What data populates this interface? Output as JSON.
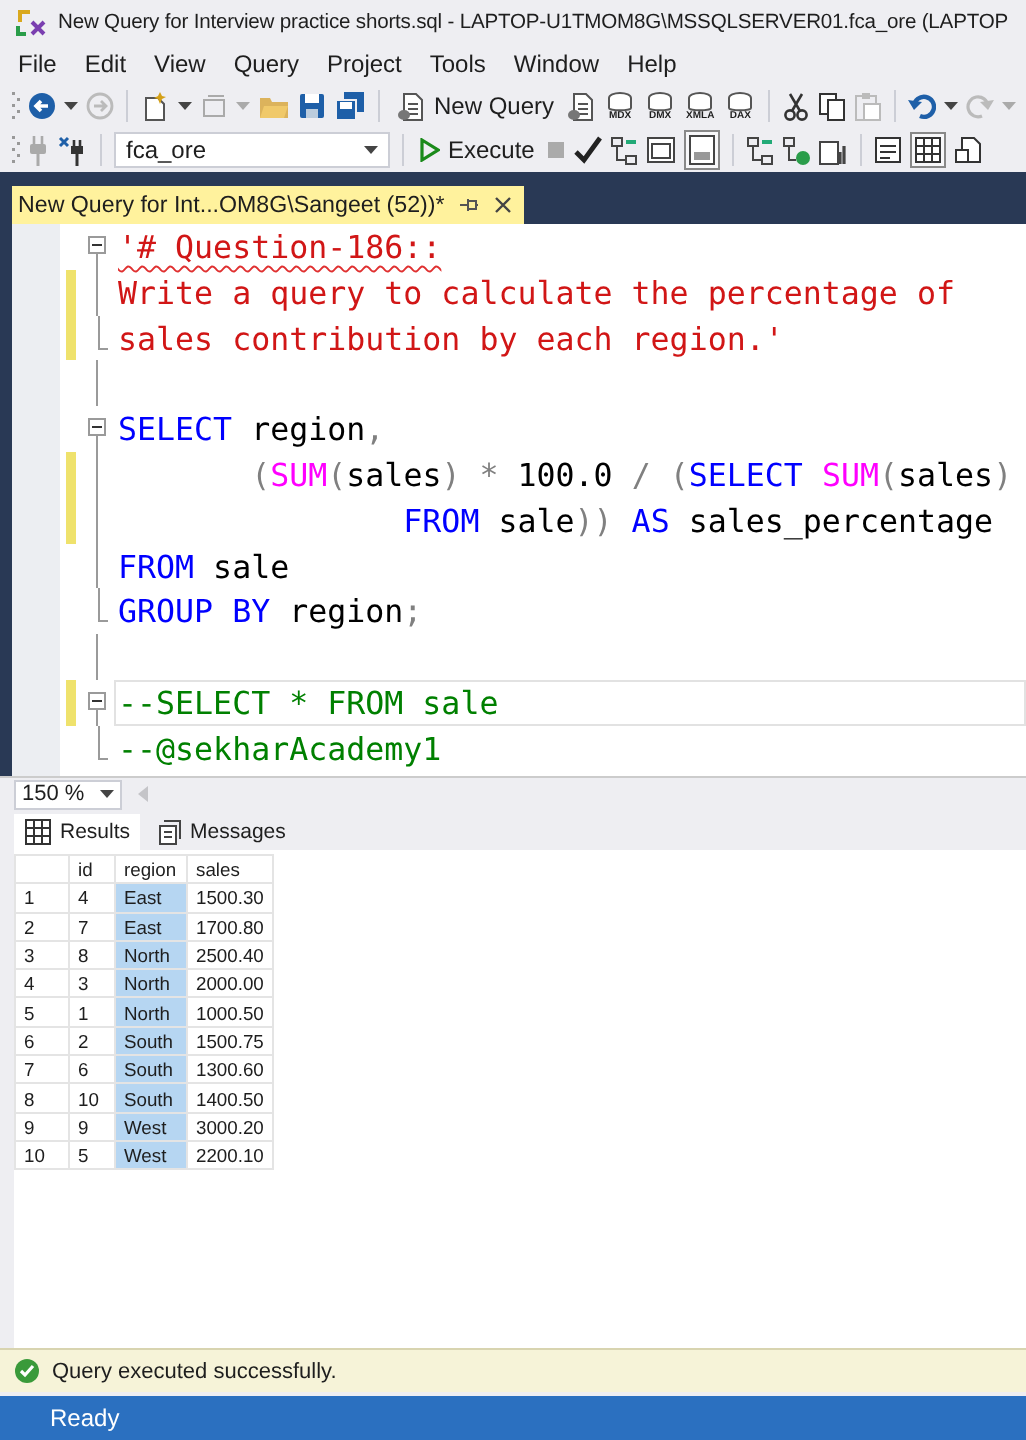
{
  "window": {
    "title": "New Query for Interview practice shorts.sql - LAPTOP-U1TMOM8G\\MSSQLSERVER01.fca_ore (LAPTOP"
  },
  "menu": [
    "File",
    "Edit",
    "View",
    "Query",
    "Project",
    "Tools",
    "Window",
    "Help"
  ],
  "toolbar": {
    "new_query": "New Query",
    "query_types": [
      "MDX",
      "DMX",
      "XMLA",
      "DAX"
    ],
    "database": "fca_ore",
    "execute": "Execute"
  },
  "document_tab": {
    "label": "New Query for Int...OM8G\\Sangeet (52))*",
    "selected": true
  },
  "editor": {
    "blocks": [
      {
        "expanded": true,
        "lines": [
          {
            "changed": false,
            "current": false,
            "squiggle": true,
            "tokens": [
              {
                "text": "'# Question-186::",
                "kind": "string"
              }
            ]
          },
          {
            "changed": true,
            "current": false,
            "squiggle": false,
            "tokens": [
              {
                "text": "Write a query to calculate the percentage of",
                "kind": "string"
              }
            ]
          },
          {
            "changed": true,
            "current": false,
            "squiggle": false,
            "tokens": [
              {
                "text": "sales contribution by each region.'",
                "kind": "string"
              }
            ]
          }
        ]
      },
      {
        "expanded": true,
        "lines": [
          {
            "changed": false,
            "current": false,
            "squiggle": false,
            "tokens": [
              {
                "text": "SELECT",
                "kind": "keyword"
              },
              {
                "text": " region",
                "kind": "plain"
              },
              {
                "text": ",",
                "kind": "operator"
              }
            ]
          },
          {
            "changed": true,
            "current": false,
            "squiggle": false,
            "tokens": [
              {
                "text": "       (",
                "kind": "operator"
              },
              {
                "text": "SUM",
                "kind": "function"
              },
              {
                "text": "(",
                "kind": "operator"
              },
              {
                "text": "sales",
                "kind": "plain"
              },
              {
                "text": ") * ",
                "kind": "operator"
              },
              {
                "text": "100.0",
                "kind": "plain"
              },
              {
                "text": " / (",
                "kind": "operator"
              },
              {
                "text": "SELECT ",
                "kind": "keyword"
              },
              {
                "text": "SUM",
                "kind": "function"
              },
              {
                "text": "(",
                "kind": "operator"
              },
              {
                "text": "sales",
                "kind": "plain"
              },
              {
                "text": ")",
                "kind": "operator"
              }
            ]
          },
          {
            "changed": true,
            "current": false,
            "squiggle": false,
            "tokens": [
              {
                "text": "               FROM",
                "kind": "keyword"
              },
              {
                "text": " sale",
                "kind": "plain"
              },
              {
                "text": "))",
                "kind": "operator"
              },
              {
                "text": " AS",
                "kind": "keyword"
              },
              {
                "text": " sales_percentage",
                "kind": "plain"
              }
            ]
          },
          {
            "changed": false,
            "current": false,
            "squiggle": false,
            "tokens": [
              {
                "text": "FROM",
                "kind": "keyword"
              },
              {
                "text": " sale",
                "kind": "plain"
              }
            ]
          },
          {
            "changed": false,
            "current": false,
            "squiggle": false,
            "tokens": [
              {
                "text": "GROUP BY",
                "kind": "keyword"
              },
              {
                "text": " region",
                "kind": "plain"
              },
              {
                "text": ";",
                "kind": "operator"
              }
            ]
          }
        ]
      },
      {
        "expanded": true,
        "lines": [
          {
            "changed": true,
            "current": true,
            "squiggle": false,
            "tokens": [
              {
                "text": "--SELECT * FROM sale",
                "kind": "comment"
              }
            ]
          },
          {
            "changed": false,
            "current": false,
            "squiggle": false,
            "tokens": [
              {
                "text": "--@sekharAcademy1",
                "kind": "comment"
              }
            ]
          }
        ]
      }
    ]
  },
  "zoom": "150 %",
  "result_tabs": [
    {
      "label": "Results",
      "selected": true
    },
    {
      "label": "Messages",
      "selected": false
    }
  ],
  "grid": {
    "columns": [
      {
        "label": "id",
        "selected": false
      },
      {
        "label": "region",
        "selected": true
      },
      {
        "label": "sales",
        "selected": false
      }
    ],
    "rows": [
      {
        "number": "1",
        "cells": [
          "4",
          "East",
          "1500.30"
        ]
      },
      {
        "number": "2",
        "cells": [
          "7",
          "East",
          "1700.80"
        ]
      },
      {
        "number": "3",
        "cells": [
          "8",
          "North",
          "2500.40"
        ]
      },
      {
        "number": "4",
        "cells": [
          "3",
          "North",
          "2000.00"
        ]
      },
      {
        "number": "5",
        "cells": [
          "1",
          "North",
          "1000.50"
        ]
      },
      {
        "number": "6",
        "cells": [
          "2",
          "South",
          "1500.75"
        ]
      },
      {
        "number": "7",
        "cells": [
          "6",
          "South",
          "1300.60"
        ]
      },
      {
        "number": "8",
        "cells": [
          "10",
          "South",
          "1400.50"
        ]
      },
      {
        "number": "9",
        "cells": [
          "9",
          "West",
          "3000.20"
        ]
      },
      {
        "number": "10",
        "cells": [
          "5",
          "West",
          "2200.10"
        ]
      }
    ]
  },
  "query_status": "Query executed successfully.",
  "status_bar": "Ready"
}
